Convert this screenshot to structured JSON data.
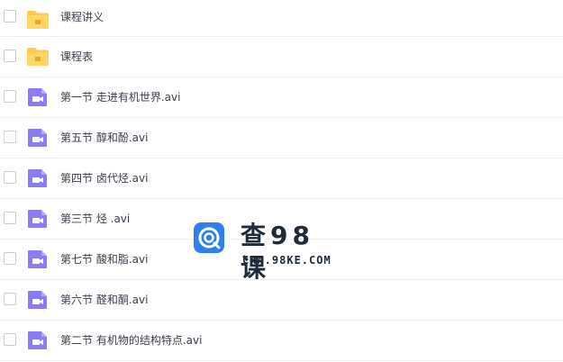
{
  "files": [
    {
      "name": "课程讲义",
      "icon": "folder-icon"
    },
    {
      "name": "课程表",
      "icon": "folder-icon"
    },
    {
      "name": "第一节 走进有机世界.avi",
      "icon": "video-file-icon"
    },
    {
      "name": "第五节 醇和酚.avi",
      "icon": "video-file-icon"
    },
    {
      "name": "第四节 卤代烃.avi",
      "icon": "video-file-icon"
    },
    {
      "name": "第三节 烃 .avi",
      "icon": "video-file-icon"
    },
    {
      "name": "第七节 酸和脂.avi",
      "icon": "video-file-icon"
    },
    {
      "name": "第六节 醛和酮.avi",
      "icon": "video-file-icon"
    },
    {
      "name": "第二节 有机物的结构特点.avi",
      "icon": "video-file-icon"
    }
  ],
  "watermark": {
    "title": "查98课",
    "subtitle": "CHA.98KE.COM"
  },
  "colors": {
    "folder": "#ffc94d",
    "video": "#8b7cf6",
    "logo": "#2f80ed"
  }
}
